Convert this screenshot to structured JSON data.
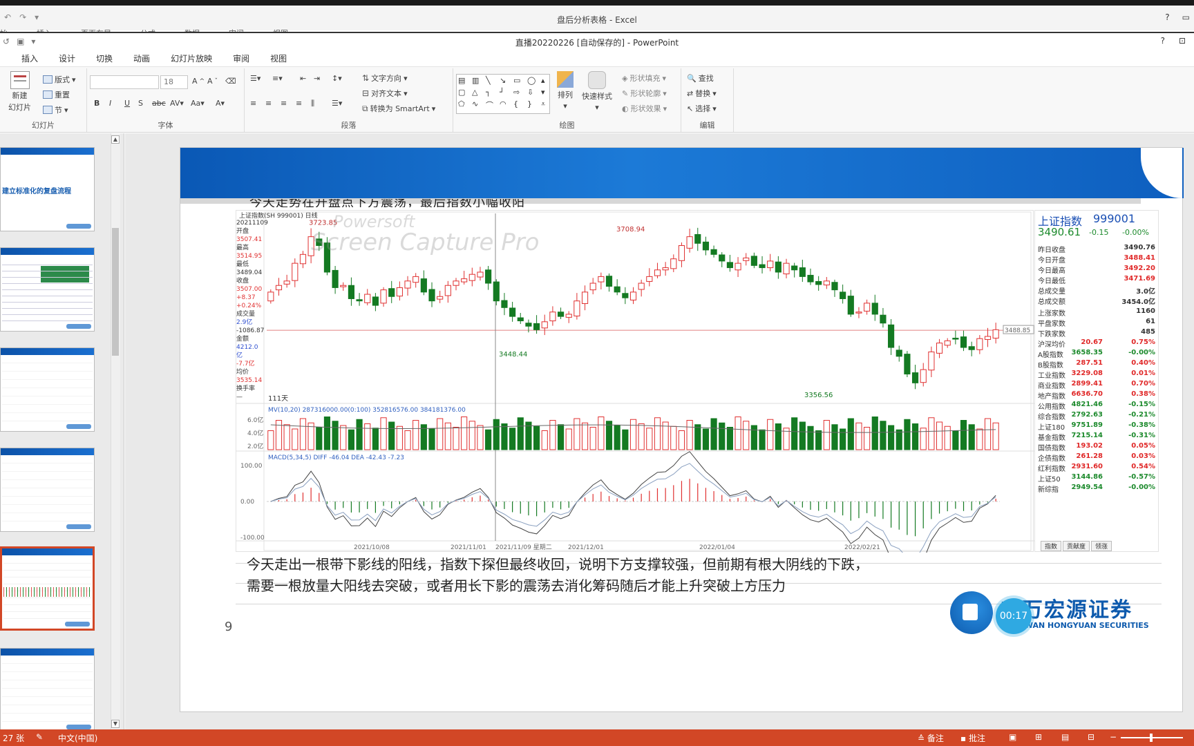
{
  "excel": {
    "title": "盘后分析表格 - Excel",
    "tabs": [
      "始",
      "插入",
      "页面布局",
      "公式",
      "数据",
      "审阅",
      "视图"
    ],
    "help": "?"
  },
  "ppt": {
    "title": "直播20220226 [自动保存的] - PowerPoint",
    "help": "?",
    "menu": [
      "插入",
      "设计",
      "切换",
      "动画",
      "幻灯片放映",
      "审阅",
      "视图"
    ]
  },
  "ribbon": {
    "slides_group": {
      "label": "幻灯片",
      "new_slide": "新建",
      "new_slide2": "幻灯片",
      "layout": "版式",
      "reset": "重置",
      "section": "节"
    },
    "font_group": {
      "label": "字体",
      "size": "18"
    },
    "paragraph_group": {
      "label": "段落",
      "text_direction": "文字方向",
      "align_text": "对齐文本",
      "smartart": "转换为 SmartArt"
    },
    "drawing_group": {
      "label": "绘图",
      "arrange": "排列",
      "quick_styles": "快速样式",
      "fill": "形状填充",
      "outline": "形状轮廓",
      "effects": "形状效果"
    },
    "editing_group": {
      "label": "编辑",
      "find": "查找",
      "replace": "替换",
      "select": "选择"
    }
  },
  "thumbnails": {
    "first_title": "建立标准化的复盘流程"
  },
  "slide": {
    "clipped_text": "今天走势在开盘点下方震荡，最后指数小幅收阳",
    "body_line1": "今天走出一根带下影线的阳线，指数下探但最终收回，说明下方支撑较强，但前期有根大阴线的下跌，",
    "body_line2": "需要一根放量大阳线去突破，或者用长下影的震荡去消化筹码随后才能上升突破上方压力",
    "page_number": "9",
    "logo_cn": "申万宏源证券",
    "logo_en": "SHENWAN HONGYUAN SECURITIES",
    "timer": "00:17",
    "watermark_1": "Powersoft",
    "watermark_2": "Screen Capture Pro"
  },
  "chart_header": {
    "index_label": "上证指数(SH 999001)",
    "period": "日线",
    "days": "111天"
  },
  "left_info": [
    {
      "t": "20211109",
      "c": ""
    },
    {
      "t": "开盘",
      "c": ""
    },
    {
      "t": "3507.41",
      "c": "red"
    },
    {
      "t": "最高",
      "c": ""
    },
    {
      "t": "3514.95",
      "c": "red"
    },
    {
      "t": "最低",
      "c": ""
    },
    {
      "t": "3489.04",
      "c": ""
    },
    {
      "t": "收盘",
      "c": ""
    },
    {
      "t": "3507.00",
      "c": "red"
    },
    {
      "t": "+8.37",
      "c": "red"
    },
    {
      "t": "+0.24%",
      "c": "red"
    },
    {
      "t": "成交量",
      "c": ""
    },
    {
      "t": "2.9亿",
      "c": "blue"
    },
    {
      "t": "-1086.87",
      "c": ""
    },
    {
      "t": "金额",
      "c": ""
    },
    {
      "t": "4212.0亿",
      "c": "blue"
    },
    {
      "t": "-7.7亿",
      "c": "red"
    },
    {
      "t": "均价",
      "c": ""
    },
    {
      "t": "3535.14",
      "c": "red"
    },
    {
      "t": "换手率",
      "c": ""
    },
    {
      "t": "—",
      "c": ""
    }
  ],
  "quote": {
    "name": "上证指数",
    "code": "999001",
    "price": "3490.61",
    "change": "-0.15",
    "pct": "-0.00%",
    "rows": [
      {
        "k": "昨日收盘",
        "v": "3490.76"
      },
      {
        "k": "今日开盘",
        "v": "3488.41"
      },
      {
        "k": "今日最高",
        "v": "3492.20"
      },
      {
        "k": "今日最低",
        "v": "3471.69"
      },
      {
        "k": "总成交量",
        "v": "3.0亿"
      },
      {
        "k": "总成交额",
        "v": "3454.0亿"
      }
    ],
    "breadth": [
      {
        "k": "上涨家数",
        "v": "1160"
      },
      {
        "k": "平盘家数",
        "v": "61"
      },
      {
        "k": "下跌家数",
        "v": "485"
      }
    ],
    "indices": [
      {
        "n": "沪深均价",
        "v": "20.67",
        "p": "0.75%",
        "vc": "r",
        "pc": "r"
      },
      {
        "n": "A股指数",
        "v": "3658.35",
        "p": "-0.00%",
        "vc": "g",
        "pc": "g"
      },
      {
        "n": "B股指数",
        "v": "287.51",
        "p": "0.40%",
        "vc": "r",
        "pc": "r"
      },
      {
        "n": "工业指数",
        "v": "3229.08",
        "p": "0.01%",
        "vc": "r",
        "pc": "r"
      },
      {
        "n": "商业指数",
        "v": "2899.41",
        "p": "0.70%",
        "vc": "r",
        "pc": "r"
      },
      {
        "n": "地产指数",
        "v": "6636.70",
        "p": "0.38%",
        "vc": "r",
        "pc": "r"
      },
      {
        "n": "公用指数",
        "v": "4821.46",
        "p": "-0.15%",
        "vc": "g",
        "pc": "g"
      },
      {
        "n": "综合指数",
        "v": "2792.63",
        "p": "-0.21%",
        "vc": "g",
        "pc": "g"
      },
      {
        "n": "上证180",
        "v": "9751.89",
        "p": "-0.38%",
        "vc": "g",
        "pc": "g"
      },
      {
        "n": "基金指数",
        "v": "7215.14",
        "p": "-0.31%",
        "vc": "g",
        "pc": "g"
      },
      {
        "n": "国债指数",
        "v": "193.02",
        "p": "0.05%",
        "vc": "r",
        "pc": "r"
      },
      {
        "n": "企债指数",
        "v": "261.28",
        "p": "0.03%",
        "vc": "r",
        "pc": "r"
      },
      {
        "n": "红利指数",
        "v": "2931.60",
        "p": "0.54%",
        "vc": "r",
        "pc": "r"
      },
      {
        "n": "上证50",
        "v": "3144.86",
        "p": "-0.57%",
        "vc": "g",
        "pc": "g"
      },
      {
        "n": "新综指",
        "v": "2949.54",
        "p": "-0.00%",
        "vc": "g",
        "pc": "g"
      }
    ],
    "tabs": [
      "指数",
      "贡献度",
      "领涨"
    ]
  },
  "chart_data": {
    "type": "candlestick",
    "price_annotations": [
      {
        "label": "3723.85",
        "kind": "high"
      },
      {
        "label": "3708.94",
        "kind": "high"
      },
      {
        "label": "3448.44",
        "kind": "low"
      },
      {
        "label": "3356.56",
        "kind": "low"
      },
      {
        "label": "3488.85",
        "kind": "last"
      }
    ],
    "x_tick_labels": [
      "2021/10/08",
      "2021/11/01",
      "2021/11/09 星期二",
      "2021/12/01",
      "2022/01/04",
      "2022/02/21"
    ],
    "closes": [
      3575,
      3590,
      3600,
      3640,
      3660,
      3700,
      3680,
      3620,
      3585,
      3590,
      3560,
      3555,
      3570,
      3545,
      3580,
      3565,
      3585,
      3600,
      3610,
      3575,
      3555,
      3565,
      3590,
      3600,
      3605,
      3615,
      3620,
      3595,
      3555,
      3540,
      3520,
      3510,
      3498,
      3490,
      3508,
      3530,
      3520,
      3525,
      3555,
      3575,
      3595,
      3610,
      3588,
      3575,
      3562,
      3575,
      3595,
      3610,
      3625,
      3630,
      3650,
      3680,
      3700,
      3685,
      3670,
      3660,
      3645,
      3630,
      3640,
      3652,
      3635,
      3630,
      3645,
      3620,
      3640,
      3625,
      3610,
      3598,
      3592,
      3600,
      3580,
      3560,
      3525,
      3530,
      3550,
      3525,
      3505,
      3450,
      3430,
      3390,
      3370,
      3400,
      3440,
      3460,
      3465,
      3470,
      3450,
      3445,
      3470,
      3475,
      3490
    ],
    "volume_ma_labels": {
      "ma": "MV(10,20)",
      "vol": "287316000.00(0:100)",
      "ma10": "352816576.00",
      "ma20": "384181376.00"
    },
    "volume_y_ticks": [
      "6.0亿",
      "4.0亿",
      "2.0亿"
    ],
    "macd_labels": {
      "title": "MACD(5,34,5)",
      "diff": "DIFF -46.04",
      "dea": "DEA -42.43",
      "macd": "-7.23"
    },
    "macd_y_ticks": [
      "100.00",
      "0.00",
      "-100.00"
    ]
  },
  "status": {
    "slides": "27 张",
    "lang": "中文(中国)",
    "notes": "备注",
    "comments": "批注"
  }
}
